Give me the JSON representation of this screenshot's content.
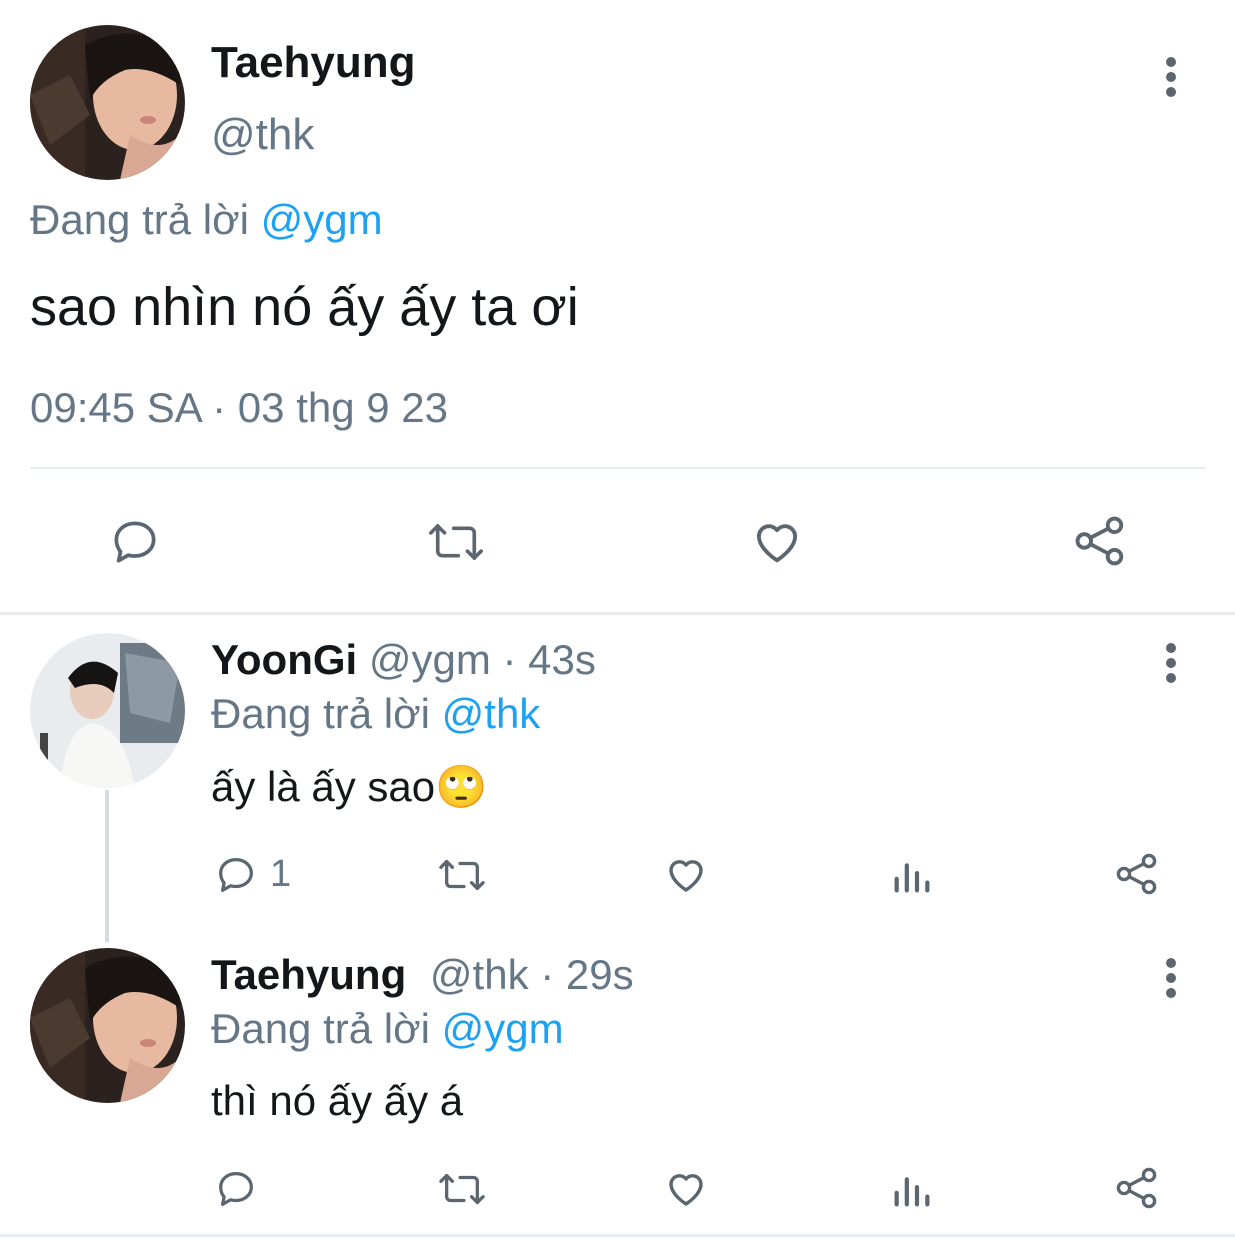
{
  "main_tweet": {
    "author_name": "Taehyung",
    "author_handle": "@thk",
    "reply_prefix": "Đang trả lời",
    "reply_to": "@ygm",
    "text": "sao nhìn nó ấy ấy ta ơi",
    "timestamp": "09:45 SA · 03 thg 9 23",
    "actions": [
      "reply-icon",
      "retweet-icon",
      "like-icon",
      "share-icon"
    ]
  },
  "replies": [
    {
      "author_name": "YoonGi",
      "author_handle": "@ygm",
      "time": "· 43s",
      "reply_prefix": "Đang trả lời",
      "reply_to": "@thk",
      "text": "ấy là ấy sao",
      "emoji": "🙄",
      "reply_count": "1",
      "actions": [
        "reply-icon",
        "retweet-icon",
        "like-icon",
        "analytics-icon",
        "share-icon"
      ]
    },
    {
      "author_name": "Taehyung",
      "author_handle": "@thk",
      "time": "· 29s",
      "reply_prefix": "Đang trả lời",
      "reply_to": "@ygm",
      "text": "thì nó ấy ấy á",
      "reply_count": "",
      "actions": [
        "reply-icon",
        "retweet-icon",
        "like-icon",
        "analytics-icon",
        "share-icon"
      ]
    }
  ],
  "colors": {
    "link": "#1da1f2",
    "muted": "#657786",
    "icon": "#5b6670",
    "divider": "#e6ecf0"
  }
}
